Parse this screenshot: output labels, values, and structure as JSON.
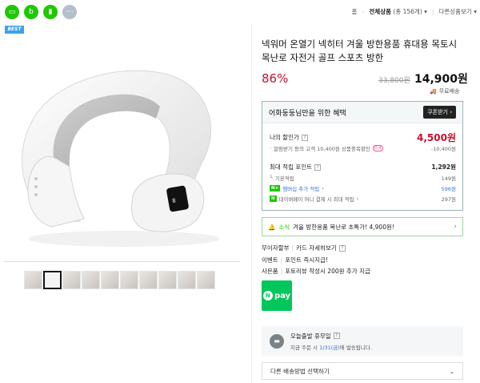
{
  "topbar": {
    "share_icons": [
      "talk-icon",
      "band-icon",
      "bookmark-icon",
      "more-icon"
    ],
    "breadcrumb_home": "홈",
    "breadcrumb_all": "전체상품",
    "breadcrumb_count": "(총 156개)",
    "breadcrumb_other": "다른상품보기"
  },
  "product": {
    "badge": "BEST",
    "title": "넥워머 온열기 넥히터 겨울 방한용품 휴대용 목토시 목난로 자전거 골프 스포츠 방한",
    "discount": "86%",
    "original_price": "33,800원",
    "price": "14,900원",
    "shipping": "무료배송",
    "thumb_count": 10
  },
  "benefit": {
    "title": "어화둥둥님만을 위한 혜택",
    "coupon_button": "쿠폰받기",
    "my_discount_label": "나의 할인가",
    "my_discount_value": "4,500원",
    "alarm_label": "알림받기 등의 고객 10,400원 상품중복할인",
    "alarm_badge": "D-4",
    "alarm_value": "-10,400원",
    "points_label": "최대 적립 포인트",
    "points_value": "1,292원",
    "basic_label": "기본적립",
    "basic_value": "149원",
    "membership_label": "멤버십 추가 적립",
    "membership_value": "596원",
    "naverpay_label": "네이버페이 머니 결제 시 최대 적립",
    "naverpay_value": "297원"
  },
  "news": {
    "prefix": "소식",
    "text": "겨울 방한용품 목난로 초특가! 4,900원!"
  },
  "info": {
    "installment": "무이자할부",
    "card_detail": "카드 자세히보기",
    "event_label": "이벤트",
    "event_text": "포인트 즉시지급!",
    "gift_label": "사은품",
    "gift_text": "포토리뷰 작성시 200원 추가 지급"
  },
  "npay": {
    "label": "pay"
  },
  "delivery": {
    "title": "오늘출발 휴무일",
    "desc_prefix": "지금 주문 시",
    "desc_date": "1/31(금)",
    "desc_suffix": "에 발송됩니다."
  },
  "select": {
    "label": "다른 배송방법 선택하기"
  },
  "colors": {
    "discount_red": "#c8102e",
    "naver_green": "#1ec800",
    "link_blue": "#3a6fd8"
  }
}
